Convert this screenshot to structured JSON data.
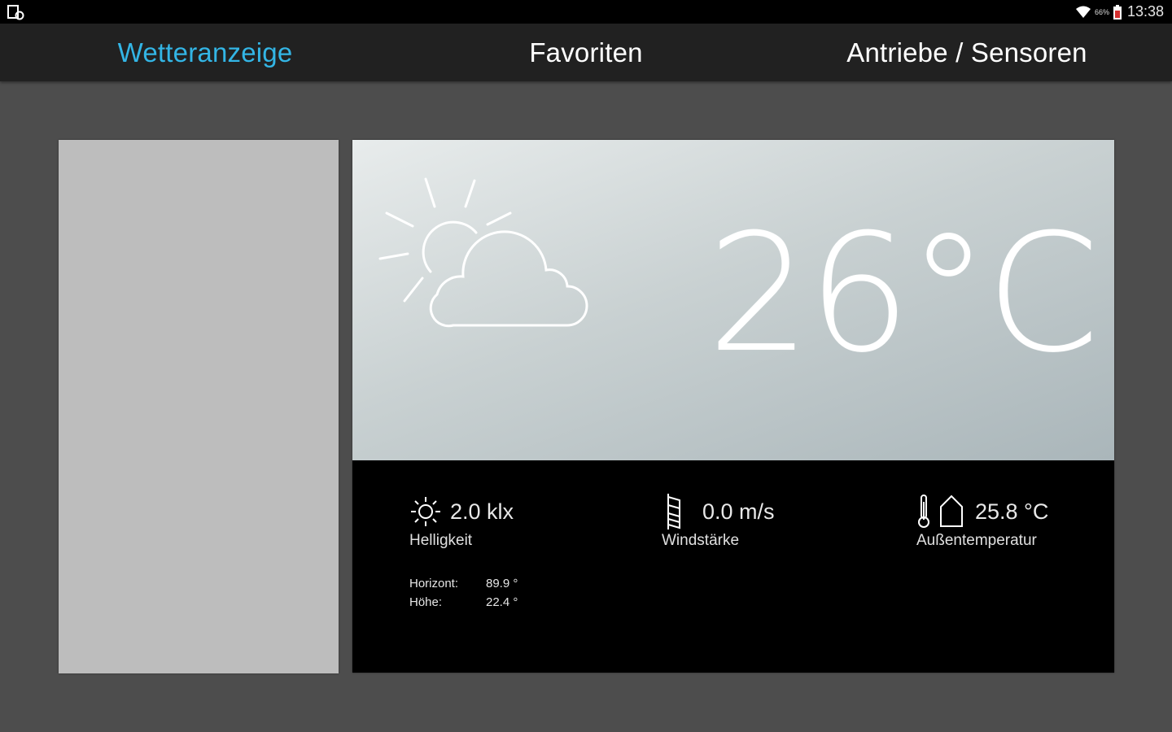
{
  "statusbar": {
    "left_icon": "notification-app-icon",
    "wifi_icon": "wifi-icon",
    "battery_percent": "66%",
    "battery_icon": "battery-icon",
    "time": "13:38"
  },
  "tabs": [
    {
      "label": "Wetteranzeige",
      "active": true
    },
    {
      "label": "Favoriten",
      "active": false
    },
    {
      "label": "Antriebe / Sensoren",
      "active": false
    }
  ],
  "weather": {
    "condition_icon": "partly-cloudy-icon",
    "temperature": "26°C",
    "metrics": [
      {
        "icon": "sun-icon",
        "value": "2.0 klx",
        "label": "Helligkeit"
      },
      {
        "icon": "windsock-icon",
        "value": "0.0 m/s",
        "label": "Windstärke"
      },
      {
        "icon": "thermometer-house-icon",
        "value": "25.8 °C",
        "label": "Außentemperatur"
      }
    ],
    "sun_position": [
      {
        "key": "Horizont:",
        "value": "89.9 °"
      },
      {
        "key": "Höhe:",
        "value": "22.4 °"
      }
    ]
  },
  "colors": {
    "accent": "#33b5e5",
    "tabbar": "#212121",
    "background": "#4d4d4d",
    "left_panel": "#bdbdbd"
  }
}
